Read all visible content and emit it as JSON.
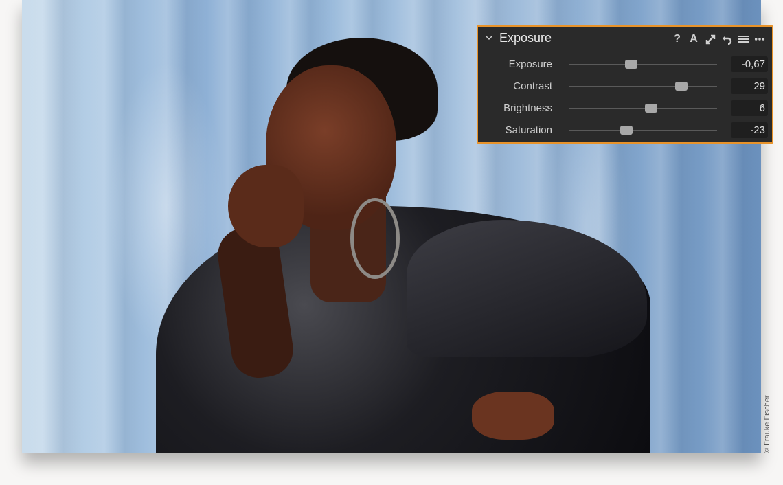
{
  "panel": {
    "title": "Exposure",
    "header_icons": [
      "collapse-chevron-icon",
      "help-icon",
      "auto-icon",
      "expand-icon",
      "reset-icon",
      "preset-menu-icon",
      "more-icon"
    ],
    "icon_glyphs": {
      "help": "?",
      "auto": "A",
      "expand": "⤢",
      "reset": "↶",
      "menu": "≡",
      "more": "⋯"
    },
    "accent_color": "#e8932a",
    "sliders": [
      {
        "label": "Exposure",
        "value": "-0,67",
        "position": 0.42
      },
      {
        "label": "Contrast",
        "value": "29",
        "position": 0.76
      },
      {
        "label": "Brightness",
        "value": "6",
        "position": 0.555
      },
      {
        "label": "Saturation",
        "value": "-23",
        "position": 0.39
      }
    ]
  },
  "credit": "© Frauke Fischer"
}
